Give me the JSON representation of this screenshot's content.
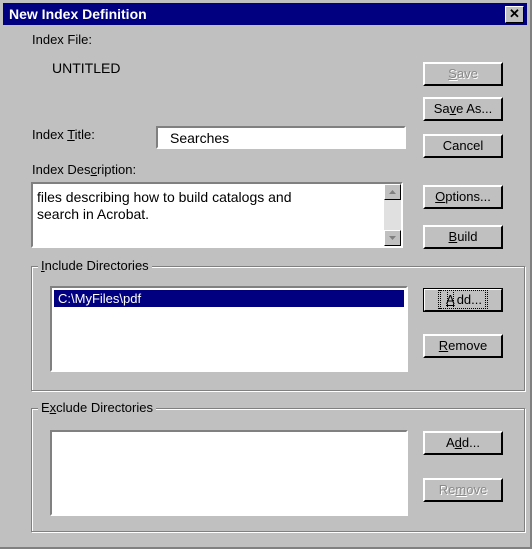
{
  "window": {
    "title": "New Index Definition",
    "close_glyph": "✕"
  },
  "index_file": {
    "label": "Index File:",
    "value": "UNTITLED"
  },
  "index_title": {
    "label_pre": "Index ",
    "label_key": "T",
    "label_post": "itle:",
    "value": "Searches"
  },
  "index_description": {
    "label_pre": "Index Des",
    "label_key": "c",
    "label_post": "ription:",
    "line1": "files describing how to build catalogs and",
    "line2": "search in Acrobat."
  },
  "buttons": {
    "save": {
      "pre": "",
      "key": "S",
      "post": "ave",
      "enabled": false
    },
    "save_as": {
      "pre": "Sa",
      "key": "v",
      "post": "e As...",
      "enabled": true
    },
    "cancel": {
      "label": "Cancel",
      "enabled": true
    },
    "options": {
      "pre": "",
      "key": "O",
      "post": "ptions...",
      "enabled": true
    },
    "build": {
      "pre": "",
      "key": "B",
      "post": "uild",
      "enabled": true
    }
  },
  "include": {
    "title_pre": "",
    "title_key": "I",
    "title_post": "nclude Directories",
    "items": [
      "C:\\MyFiles\\pdf"
    ],
    "add": {
      "pre": "",
      "key": "A",
      "post": "dd..."
    },
    "remove": {
      "pre": "",
      "key": "R",
      "post": "emove"
    }
  },
  "exclude": {
    "title_pre": "E",
    "title_key": "x",
    "title_post": "clude Directories",
    "items": [],
    "add": {
      "pre": "A",
      "key": "d",
      "post": "d..."
    },
    "remove": {
      "pre": "Re",
      "key": "m",
      "post": "ove",
      "enabled": false
    }
  }
}
